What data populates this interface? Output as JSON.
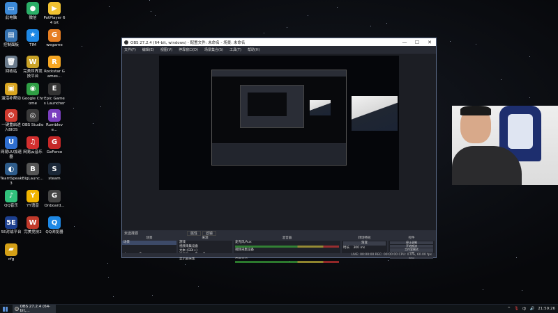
{
  "desktop_icons": [
    {
      "label": "此电脑",
      "glyph": "▭",
      "color": "#3d8ad8"
    },
    {
      "label": "微信",
      "glyph": "●",
      "color": "#2aae67"
    },
    {
      "label": "PotPlayer 64 bit",
      "glyph": "▶",
      "color": "#f1c232"
    },
    {
      "label": "控制面板",
      "glyph": "▤",
      "color": "#3572b0"
    },
    {
      "label": "TIM",
      "glyph": "★",
      "color": "#1e88e5"
    },
    {
      "label": "wegame",
      "glyph": "G",
      "color": "#e67e22"
    },
    {
      "label": "回收站",
      "glyph": "🗑",
      "color": "#6b7b8c"
    },
    {
      "label": "完美世界竞技平台",
      "glyph": "W",
      "color": "#c9a227"
    },
    {
      "label": "Rockstar Games...",
      "glyph": "R",
      "color": "#f5a623"
    },
    {
      "label": "激活补帮动",
      "glyph": "▣",
      "color": "#d9a520"
    },
    {
      "label": "Google Chrome",
      "glyph": "◉",
      "color": "#2f9e44"
    },
    {
      "label": "Epic Games Launcher",
      "glyph": "E",
      "color": "#333333"
    },
    {
      "label": "一键重启进入BIOS",
      "glyph": "⏻",
      "color": "#d03a2f"
    },
    {
      "label": "OBS Studio",
      "glyph": "◎",
      "color": "#3a3a3a"
    },
    {
      "label": "Rumbleve...",
      "glyph": "R",
      "color": "#7b3fbf"
    },
    {
      "label": "网易UU加速器",
      "glyph": "U",
      "color": "#2f6fd1"
    },
    {
      "label": "网易云音乐",
      "glyph": "♫",
      "color": "#d32f2f"
    },
    {
      "label": "GeForce",
      "glyph": "G",
      "color": "#c62828"
    },
    {
      "label": "TeamSpeak 3",
      "glyph": "◐",
      "color": "#2e5c8a"
    },
    {
      "label": "BigLaunc...",
      "glyph": "B",
      "color": "#555555"
    },
    {
      "label": "steam",
      "glyph": "S",
      "color": "#1b2838"
    },
    {
      "label": "QQ音乐",
      "glyph": "♪",
      "color": "#31c27c"
    },
    {
      "label": "YY语音",
      "glyph": "Y",
      "color": "#f0b400"
    },
    {
      "label": "Onboard...",
      "glyph": "G",
      "color": "#444444"
    },
    {
      "label": "5E对战平台",
      "glyph": "5E",
      "color": "#1c3f8f"
    },
    {
      "label": "完美竞技2",
      "glyph": "W",
      "color": "#c0392b"
    },
    {
      "label": "QQ浏览器",
      "glyph": "Q",
      "color": "#1e88e5"
    },
    {
      "label": "cfg",
      "glyph": "▰",
      "color": "#d4a017"
    }
  ],
  "obs": {
    "title": "OBS 27.2.4 (64-bit, windows) - 配置文件: 未命名 - 场景: 未命名",
    "window_controls": [
      "—",
      "☐",
      "✕"
    ],
    "menu": [
      "文件(F)",
      "编辑(E)",
      "视图(V)",
      "停靠窗口(D)",
      "场景集合(S)",
      "工具(T)",
      "帮助(H)"
    ],
    "dock_header_left": "未选择源",
    "dock_header_tabs": [
      "属性",
      "滤镜"
    ],
    "docks": {
      "scenes_title": "场景",
      "scenes": [
        "场景"
      ],
      "sources_title": "来源",
      "sources": [
        "游戏",
        "视频采集设备",
        "文本 (GDI+)",
        "显示器",
        "显示器采集"
      ],
      "mixer_title": "混音器",
      "mixer_channels": [
        "麦克风/Aux",
        "视频采集设备",
        "桌面音频"
      ],
      "transitions_title": "转场特效",
      "transition_type": "渐变",
      "duration_label": "时长",
      "duration_value": "300 ms",
      "controls_title": "控件",
      "controls": [
        "停止录制",
        "开始推流",
        "工作室模式",
        "设置",
        "退出"
      ]
    },
    "status": "LIVE: 00:00:00   REC: 00:00:00   CPU: 0.0%, 60.00 fps"
  },
  "taskbar": {
    "task_item": "OBS 27.2.4 (64-bit,...",
    "tray_icons": [
      "^",
      "🎙",
      "中",
      "🔊"
    ],
    "clock": "21:59:26"
  }
}
